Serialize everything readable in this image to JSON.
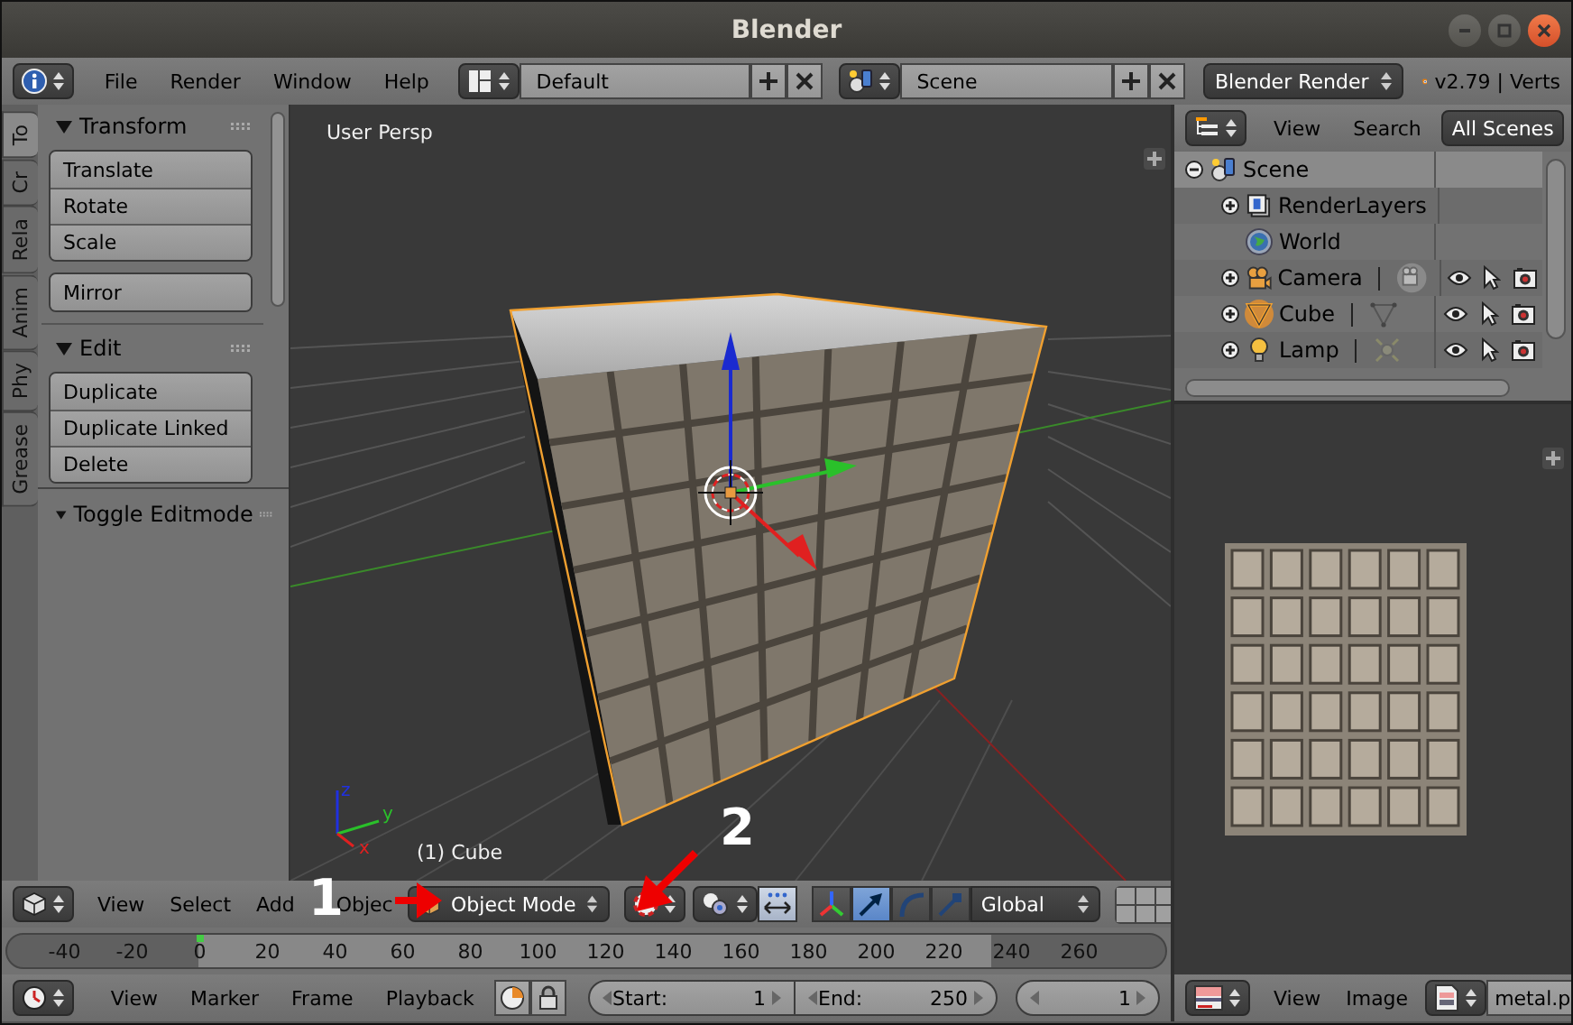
{
  "window": {
    "title": "Blender"
  },
  "info_header": {
    "menus": [
      "File",
      "Render",
      "Window",
      "Help"
    ],
    "layout": "Default",
    "scene": "Scene",
    "engine": "Blender Render",
    "version": "v2.79 | Verts"
  },
  "tool_shelf": {
    "tabs": [
      {
        "label": "To",
        "selected": true
      },
      {
        "label": "Cr",
        "selected": false
      },
      {
        "label": "Rela",
        "selected": false
      },
      {
        "label": "Anim",
        "selected": false
      },
      {
        "label": "Phy",
        "selected": false
      },
      {
        "label": "Grease",
        "selected": false
      }
    ],
    "panels": [
      {
        "title": "Transform",
        "expanded": true,
        "groups": [
          [
            "Translate",
            "Rotate",
            "Scale"
          ],
          [
            "Mirror"
          ]
        ]
      },
      {
        "title": "Edit",
        "expanded": true,
        "groups": [
          [
            "Duplicate",
            "Duplicate Linked",
            "Delete"
          ]
        ]
      }
    ],
    "operator_panel": {
      "title": "Toggle Editmode",
      "expanded": true
    }
  },
  "viewport": {
    "view_name": "User Persp",
    "object_info": "(1) Cube",
    "axis_labels": [
      "x",
      "y",
      "z"
    ]
  },
  "view3d_header": {
    "menus": [
      "View",
      "Select",
      "Add",
      "Objec"
    ],
    "mode": "Object Mode",
    "manipulators": [
      {
        "kind": "toggle",
        "selected": false
      },
      {
        "kind": "translate",
        "selected": true
      },
      {
        "kind": "rotate",
        "selected": false
      },
      {
        "kind": "scale",
        "selected": false
      }
    ],
    "orientation": "Global"
  },
  "timeline": {
    "ruler": [
      {
        "label": "-40",
        "current": false
      },
      {
        "label": "-20",
        "current": false
      },
      {
        "label": "0",
        "current": true
      },
      {
        "label": "20",
        "current": false
      },
      {
        "label": "40",
        "current": false
      },
      {
        "label": "60",
        "current": false
      },
      {
        "label": "80",
        "current": false
      },
      {
        "label": "100",
        "current": false
      },
      {
        "label": "120",
        "current": false
      },
      {
        "label": "140",
        "current": false
      },
      {
        "label": "160",
        "current": false
      },
      {
        "label": "180",
        "current": false
      },
      {
        "label": "200",
        "current": false
      },
      {
        "label": "220",
        "current": false
      },
      {
        "label": "240",
        "current": false
      },
      {
        "label": "260",
        "current": false
      }
    ],
    "menus": [
      "View",
      "Marker",
      "Frame",
      "Playback"
    ],
    "start": {
      "label": "Start:",
      "value": "1"
    },
    "end": {
      "label": "End:",
      "value": "250"
    },
    "current_frame": "1"
  },
  "outliner": {
    "menus": [
      "View",
      "Search"
    ],
    "filter": "All Scenes",
    "tree": [
      {
        "label": "Scene",
        "kind": "scene",
        "expandable": true,
        "expanded": true,
        "selected": true,
        "active": false,
        "children": [
          {
            "label": "RenderLayers",
            "kind": "renderlayers",
            "expandable": true,
            "expanded": false,
            "selected": false,
            "active": false
          },
          {
            "label": "World",
            "kind": "world",
            "expandable": false,
            "selected": false,
            "active": false
          },
          {
            "label": "Camera",
            "kind": "camera",
            "expandable": true,
            "expanded": false,
            "selected": false,
            "active": false
          },
          {
            "label": "Cube",
            "kind": "mesh",
            "expandable": true,
            "expanded": false,
            "selected": false,
            "active": true
          },
          {
            "label": "Lamp",
            "kind": "lamp",
            "expandable": true,
            "expanded": false,
            "selected": false,
            "active": false
          }
        ]
      }
    ]
  },
  "image_editor": {
    "menus": [
      "View",
      "Image"
    ],
    "image_name": "metal.p"
  },
  "annotations": [
    {
      "label": "1",
      "kind": "arrow-right"
    },
    {
      "label": "2",
      "kind": "arrow-down-left"
    }
  ]
}
